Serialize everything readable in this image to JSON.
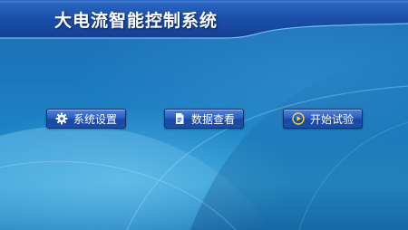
{
  "header": {
    "title": "大电流智能控制系统"
  },
  "menu": {
    "settings_label": "系统设置",
    "data_label": "数据查看",
    "start_label": "开始试验"
  },
  "icons": {
    "settings": "gear-icon",
    "data": "document-icon",
    "start": "play-icon"
  },
  "colors": {
    "background": "#1a86c6",
    "title_bar": "#1b4fa8",
    "button": "#2a5fbf",
    "play_icon": "#ffd23a"
  }
}
